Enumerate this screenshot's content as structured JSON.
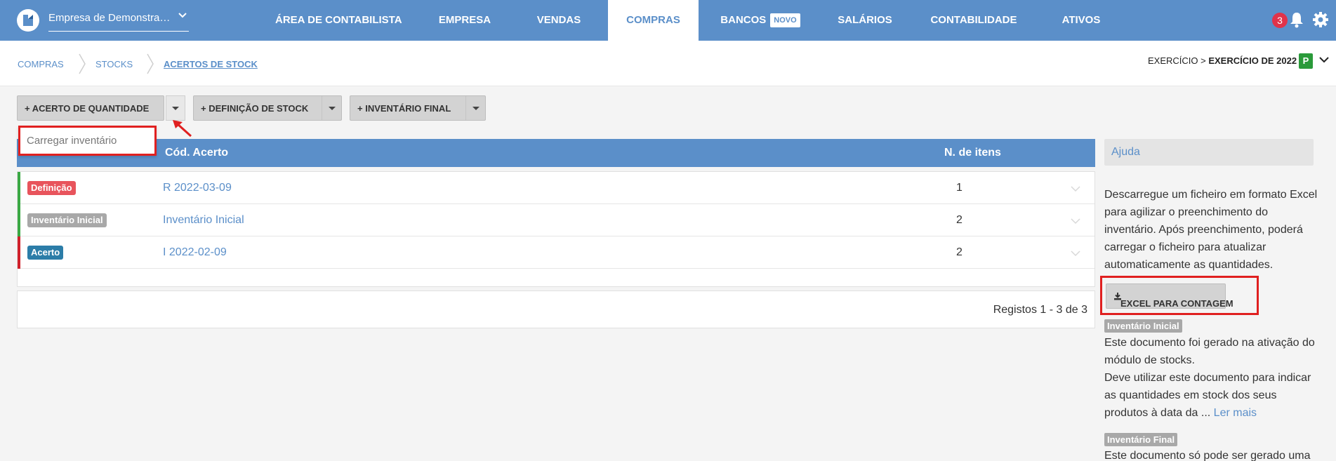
{
  "header": {
    "company": "Empresa de Demonstração",
    "nav": [
      "ÁREA DE CONTABILISTA",
      "EMPRESA",
      "VENDAS",
      "COMPRAS",
      "BANCOS",
      "SALÁRIOS",
      "CONTABILIDADE",
      "ATIVOS"
    ],
    "active_nav": "COMPRAS",
    "new_badge": "NOVO",
    "notifications": "3"
  },
  "breadcrumb": [
    "COMPRAS",
    "STOCKS",
    "ACERTOS DE STOCK"
  ],
  "exercise": {
    "prefix": "EXERCÍCIO >",
    "value": "EXERCÍCIO DE 2022",
    "status": "P"
  },
  "actions": {
    "acerto": "+ ACERTO DE QUANTIDADE",
    "definicao": "+ DEFINIÇÃO DE STOCK",
    "inventario": "+ INVENTÁRIO FINAL",
    "dropdown_item": "Carregar inventário"
  },
  "table": {
    "headers": [
      "Cód. Acerto",
      "N. de itens"
    ],
    "rows": [
      {
        "type": "Definição",
        "code": "R 2022-03-09",
        "count": "1"
      },
      {
        "type": "Inventário Inicial",
        "code": "Inventário Inicial",
        "count": "2"
      },
      {
        "type": "Acerto",
        "code": "I 2022-02-09",
        "count": "2"
      }
    ],
    "footer": "Registos 1 - 3 de 3"
  },
  "help": {
    "title": "Ajuda",
    "intro": "Descarregue um ficheiro em formato Excel para agilizar o preenchimento do inventário. Após preenchimento, poderá carregar o ficheiro para atualizar automaticamente as quantidades.",
    "excel_button": "EXCEL PARA CONTAGEM",
    "tag_inicial": "Inventário Inicial",
    "inicial_text": "Este documento foi gerado na ativação do módulo de stocks.",
    "inicial_text2": "Deve utilizar este documento para indicar as quantidades em stock dos seus produtos à data da ...",
    "read_more": "Ler mais",
    "tag_final": "Inventário Final",
    "final_text": "Este documento só pode ser gerado uma"
  },
  "colors": {
    "primary": "#5b8fc9",
    "definicao": "#e8545c",
    "inicial": "#a8a8a8",
    "acerto": "#2c7da8",
    "green_bar": "#3aa843",
    "red_bar": "#d0202a"
  }
}
